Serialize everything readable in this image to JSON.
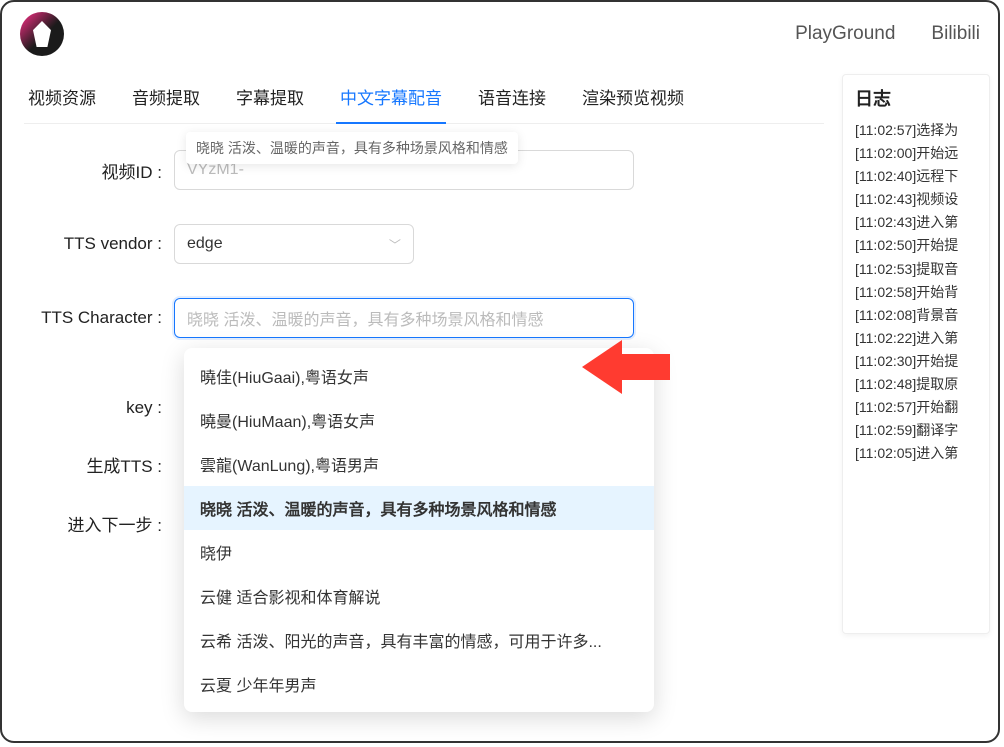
{
  "topnav": {
    "playground": "PlayGround",
    "bilibili": "Bilibili"
  },
  "tabs": [
    {
      "label": "视频资源"
    },
    {
      "label": "音频提取"
    },
    {
      "label": "字幕提取"
    },
    {
      "label": "中文字幕配音"
    },
    {
      "label": "语音连接"
    },
    {
      "label": "渲染预览视频"
    }
  ],
  "active_tab_index": 3,
  "tooltip": "晓晓 活泼、温暖的声音，具有多种场景风格和情感",
  "form": {
    "video_id_label": "视频ID :",
    "video_id_value": "VYzM1-",
    "tts_vendor_label": "TTS vendor :",
    "tts_vendor_value": "edge",
    "tts_character_label": "TTS Character :",
    "tts_character_placeholder": "晓晓 活泼、温暖的声音，具有多种场景风格和情感",
    "key_label": "key :",
    "generate_label": "生成TTS :",
    "next_step_label": "进入下一步 :"
  },
  "dropdown": {
    "highlight_index": 3,
    "options": [
      "曉佳(HiuGaai),粤语女声",
      "曉曼(HiuMaan),粤语女声",
      "雲龍(WanLung),粤语男声",
      "晓晓 活泼、温暖的声音，具有多种场景风格和情感",
      "晓伊",
      "云健 适合影视和体育解说",
      "云希 活泼、阳光的声音，具有丰富的情感，可用于许多...",
      "云夏 少年年男声"
    ]
  },
  "log": {
    "title": "日志",
    "entries": [
      "[11:02:57]选择为",
      "[11:02:00]开始远",
      "[11:02:40]远程下",
      "[11:02:43]视频设",
      "[11:02:43]进入第",
      "[11:02:50]开始提",
      "[11:02:53]提取音",
      "[11:02:58]开始背",
      "[11:02:08]背景音",
      "[11:02:22]进入第",
      "[11:02:30]开始提",
      "[11:02:48]提取原",
      "[11:02:57]开始翻",
      "[11:02:59]翻译字",
      "[11:02:05]进入第"
    ]
  }
}
